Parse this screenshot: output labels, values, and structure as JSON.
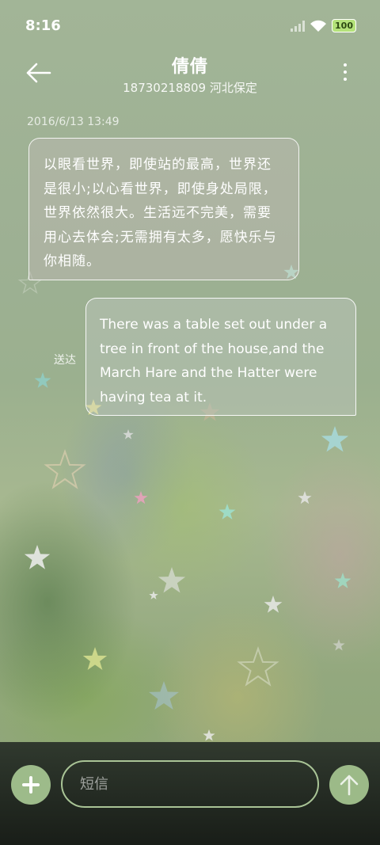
{
  "status_bar": {
    "time": "8:16",
    "battery": "100",
    "icons": [
      "signal-icon",
      "wifi-icon",
      "battery-icon"
    ]
  },
  "header": {
    "contact_name": "倩倩",
    "contact_sub": "18730218809 河北保定",
    "back_icon": "arrow-left-icon",
    "more_icon": "more-vertical-icon"
  },
  "messages": [
    {
      "timestamp": "2016/6/13 13:49",
      "direction": "incoming",
      "text": "以眼看世界，即使站的最高，世界还是很小;以心看世界，即使身处局限，世界依然很大。生活远不完美，需要用心去体会;无需拥有太多，愿快乐与你相随。"
    },
    {
      "direction": "outgoing",
      "status": "送达",
      "text": "There was a table set out under a tree in front of the house,and the March Hare and the Hatter were having tea at it."
    }
  ],
  "compose": {
    "placeholder": "短信",
    "add_icon": "plus-icon",
    "send_icon": "arrow-up-icon"
  },
  "colors": {
    "accent": "#9dbb8a",
    "input_border": "#a9c496",
    "battery": "#b4e27a"
  }
}
